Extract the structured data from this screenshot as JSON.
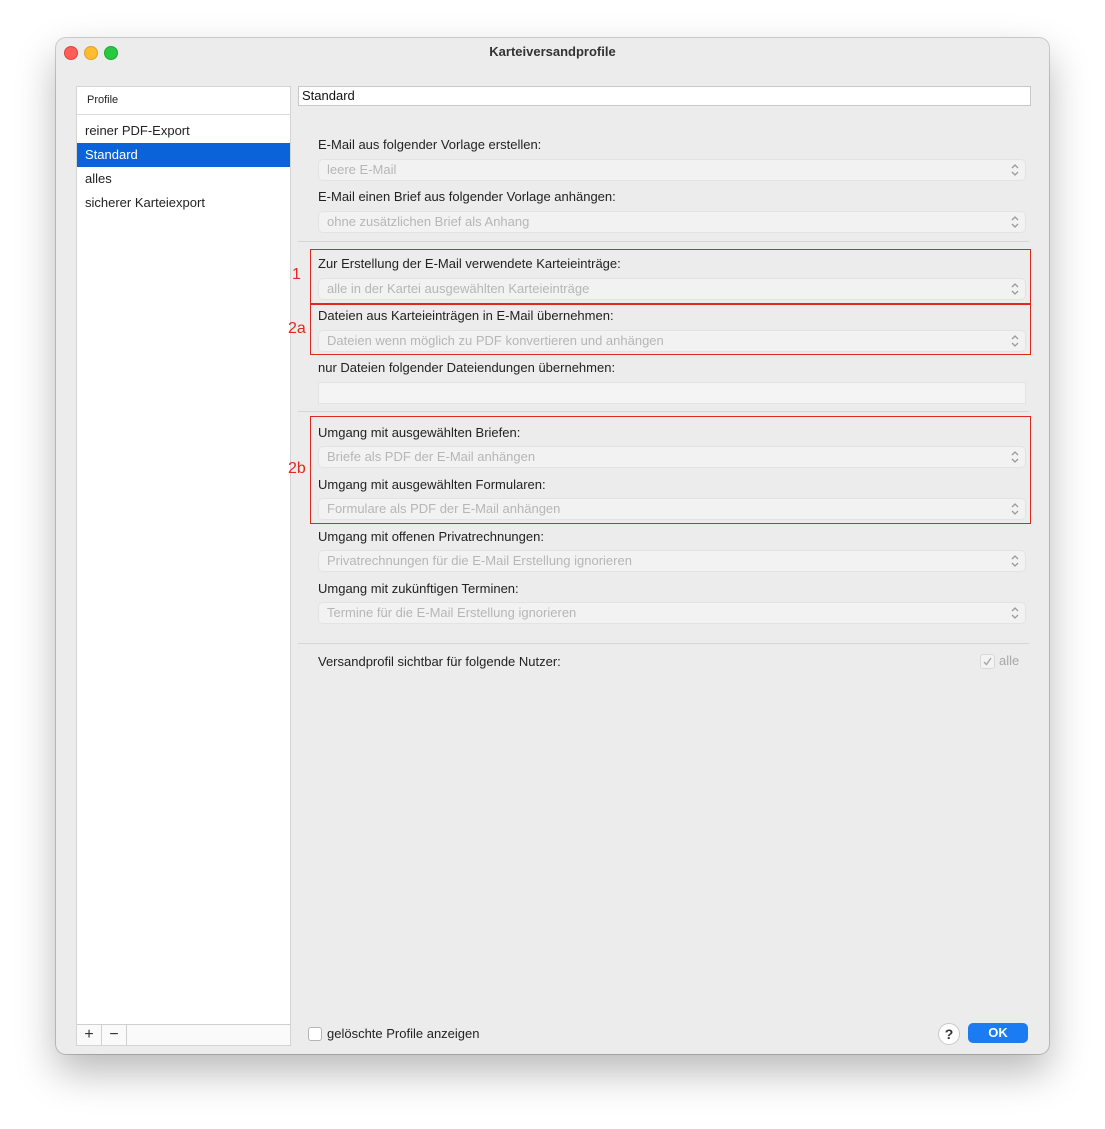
{
  "window": {
    "title": "Karteiversandprofile"
  },
  "sidebar": {
    "header": "Profile",
    "items": [
      {
        "label": "reiner PDF-Export",
        "selected": false
      },
      {
        "label": "Standard",
        "selected": true
      },
      {
        "label": "alles",
        "selected": false
      },
      {
        "label": "sicherer Karteiexport",
        "selected": false
      }
    ],
    "add_label": "+",
    "remove_label": "−"
  },
  "profile": {
    "name": "Standard",
    "vorlage_label": "E-Mail aus folgender Vorlage erstellen:",
    "vorlage_value": "leere E-Mail",
    "brief_label": "E-Mail einen Brief aus folgender Vorlage anhängen:",
    "brief_value": "ohne zusätzlichen Brief als Anhang",
    "eintraege_label": "Zur Erstellung der E-Mail verwendete Karteieinträge:",
    "eintraege_value": "alle in der Kartei ausgewählten Karteieinträge",
    "dateien_label": "Dateien aus Karteieinträgen in E-Mail übernehmen:",
    "dateien_value": "Dateien wenn möglich zu PDF konvertieren und anhängen",
    "endungen_label": "nur Dateien folgender Dateiendungen übernehmen:",
    "endungen_value": "",
    "briefe_label": "Umgang mit ausgewählten Briefen:",
    "briefe_value": "Briefe als PDF der E-Mail anhängen",
    "formulare_label": "Umgang mit ausgewählten Formularen:",
    "formulare_value": "Formulare als PDF der E-Mail anhängen",
    "privat_label": "Umgang mit offenen Privatrechnungen:",
    "privat_value": "Privatrechnungen für die E-Mail Erstellung ignorieren",
    "termine_label": "Umgang mit zukünftigen Terminen:",
    "termine_value": "Termine für die E-Mail Erstellung ignorieren",
    "nutzer_label": "Versandprofil sichtbar für folgende Nutzer:",
    "nutzer_checkbox_label": "alle",
    "nutzer_checked": true
  },
  "annotations": {
    "box1": "1",
    "box2a": "2a",
    "box2b": "2b",
    "color": "#e0291e"
  },
  "footer": {
    "show_deleted_label": "gelöschte Profile anzeigen",
    "show_deleted_checked": false,
    "help_label": "?",
    "ok_label": "OK"
  },
  "colors": {
    "accent": "#0a63d8",
    "ok_button": "#1a7bf2"
  }
}
